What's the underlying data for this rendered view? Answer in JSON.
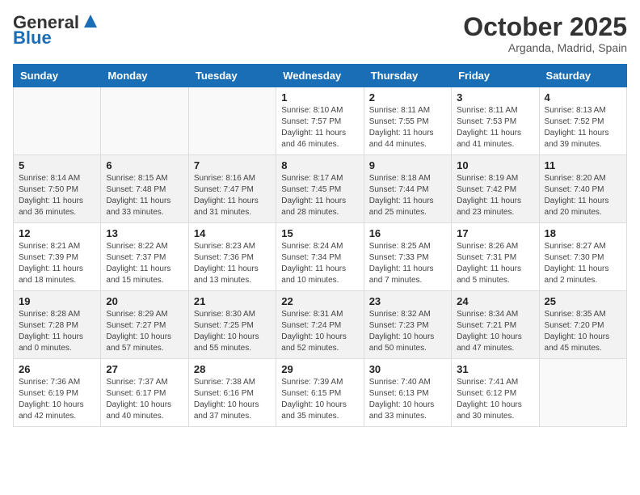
{
  "header": {
    "logo_general": "General",
    "logo_blue": "Blue",
    "month_title": "October 2025",
    "location": "Arganda, Madrid, Spain"
  },
  "days_of_week": [
    "Sunday",
    "Monday",
    "Tuesday",
    "Wednesday",
    "Thursday",
    "Friday",
    "Saturday"
  ],
  "weeks": [
    [
      {
        "day": "",
        "info": ""
      },
      {
        "day": "",
        "info": ""
      },
      {
        "day": "",
        "info": ""
      },
      {
        "day": "1",
        "info": "Sunrise: 8:10 AM\nSunset: 7:57 PM\nDaylight: 11 hours and 46 minutes."
      },
      {
        "day": "2",
        "info": "Sunrise: 8:11 AM\nSunset: 7:55 PM\nDaylight: 11 hours and 44 minutes."
      },
      {
        "day": "3",
        "info": "Sunrise: 8:11 AM\nSunset: 7:53 PM\nDaylight: 11 hours and 41 minutes."
      },
      {
        "day": "4",
        "info": "Sunrise: 8:13 AM\nSunset: 7:52 PM\nDaylight: 11 hours and 39 minutes."
      }
    ],
    [
      {
        "day": "5",
        "info": "Sunrise: 8:14 AM\nSunset: 7:50 PM\nDaylight: 11 hours and 36 minutes."
      },
      {
        "day": "6",
        "info": "Sunrise: 8:15 AM\nSunset: 7:48 PM\nDaylight: 11 hours and 33 minutes."
      },
      {
        "day": "7",
        "info": "Sunrise: 8:16 AM\nSunset: 7:47 PM\nDaylight: 11 hours and 31 minutes."
      },
      {
        "day": "8",
        "info": "Sunrise: 8:17 AM\nSunset: 7:45 PM\nDaylight: 11 hours and 28 minutes."
      },
      {
        "day": "9",
        "info": "Sunrise: 8:18 AM\nSunset: 7:44 PM\nDaylight: 11 hours and 25 minutes."
      },
      {
        "day": "10",
        "info": "Sunrise: 8:19 AM\nSunset: 7:42 PM\nDaylight: 11 hours and 23 minutes."
      },
      {
        "day": "11",
        "info": "Sunrise: 8:20 AM\nSunset: 7:40 PM\nDaylight: 11 hours and 20 minutes."
      }
    ],
    [
      {
        "day": "12",
        "info": "Sunrise: 8:21 AM\nSunset: 7:39 PM\nDaylight: 11 hours and 18 minutes."
      },
      {
        "day": "13",
        "info": "Sunrise: 8:22 AM\nSunset: 7:37 PM\nDaylight: 11 hours and 15 minutes."
      },
      {
        "day": "14",
        "info": "Sunrise: 8:23 AM\nSunset: 7:36 PM\nDaylight: 11 hours and 13 minutes."
      },
      {
        "day": "15",
        "info": "Sunrise: 8:24 AM\nSunset: 7:34 PM\nDaylight: 11 hours and 10 minutes."
      },
      {
        "day": "16",
        "info": "Sunrise: 8:25 AM\nSunset: 7:33 PM\nDaylight: 11 hours and 7 minutes."
      },
      {
        "day": "17",
        "info": "Sunrise: 8:26 AM\nSunset: 7:31 PM\nDaylight: 11 hours and 5 minutes."
      },
      {
        "day": "18",
        "info": "Sunrise: 8:27 AM\nSunset: 7:30 PM\nDaylight: 11 hours and 2 minutes."
      }
    ],
    [
      {
        "day": "19",
        "info": "Sunrise: 8:28 AM\nSunset: 7:28 PM\nDaylight: 11 hours and 0 minutes."
      },
      {
        "day": "20",
        "info": "Sunrise: 8:29 AM\nSunset: 7:27 PM\nDaylight: 10 hours and 57 minutes."
      },
      {
        "day": "21",
        "info": "Sunrise: 8:30 AM\nSunset: 7:25 PM\nDaylight: 10 hours and 55 minutes."
      },
      {
        "day": "22",
        "info": "Sunrise: 8:31 AM\nSunset: 7:24 PM\nDaylight: 10 hours and 52 minutes."
      },
      {
        "day": "23",
        "info": "Sunrise: 8:32 AM\nSunset: 7:23 PM\nDaylight: 10 hours and 50 minutes."
      },
      {
        "day": "24",
        "info": "Sunrise: 8:34 AM\nSunset: 7:21 PM\nDaylight: 10 hours and 47 minutes."
      },
      {
        "day": "25",
        "info": "Sunrise: 8:35 AM\nSunset: 7:20 PM\nDaylight: 10 hours and 45 minutes."
      }
    ],
    [
      {
        "day": "26",
        "info": "Sunrise: 7:36 AM\nSunset: 6:19 PM\nDaylight: 10 hours and 42 minutes."
      },
      {
        "day": "27",
        "info": "Sunrise: 7:37 AM\nSunset: 6:17 PM\nDaylight: 10 hours and 40 minutes."
      },
      {
        "day": "28",
        "info": "Sunrise: 7:38 AM\nSunset: 6:16 PM\nDaylight: 10 hours and 37 minutes."
      },
      {
        "day": "29",
        "info": "Sunrise: 7:39 AM\nSunset: 6:15 PM\nDaylight: 10 hours and 35 minutes."
      },
      {
        "day": "30",
        "info": "Sunrise: 7:40 AM\nSunset: 6:13 PM\nDaylight: 10 hours and 33 minutes."
      },
      {
        "day": "31",
        "info": "Sunrise: 7:41 AM\nSunset: 6:12 PM\nDaylight: 10 hours and 30 minutes."
      },
      {
        "day": "",
        "info": ""
      }
    ]
  ]
}
